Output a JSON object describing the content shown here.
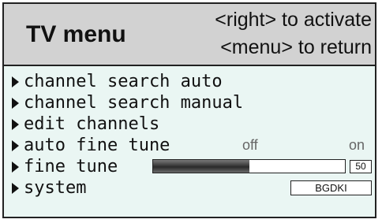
{
  "header": {
    "title": "TV menu",
    "hint_activate": "<right> to activate",
    "hint_return": "<menu> to return"
  },
  "menu": {
    "items": [
      {
        "label": "channel search auto",
        "icon": "triangle-right-icon"
      },
      {
        "label": "channel search manual",
        "icon": "triangle-right-icon"
      },
      {
        "label": "edit channels",
        "icon": "triangle-right-icon"
      },
      {
        "label": "auto fine tune",
        "icon": "triangle-right-icon",
        "option_off": "off",
        "option_on": "on"
      },
      {
        "label": "fine tune",
        "icon": "triangle-right-icon",
        "value": "50",
        "slider_fraction": 0.5
      },
      {
        "label": "system",
        "icon": "triangle-right-icon",
        "value": "BGDKI"
      }
    ]
  },
  "colors": {
    "header_bg": "#d2d2d2",
    "menu_bg": "#eaf6f3",
    "slider_fill": "#3a3a3a"
  }
}
